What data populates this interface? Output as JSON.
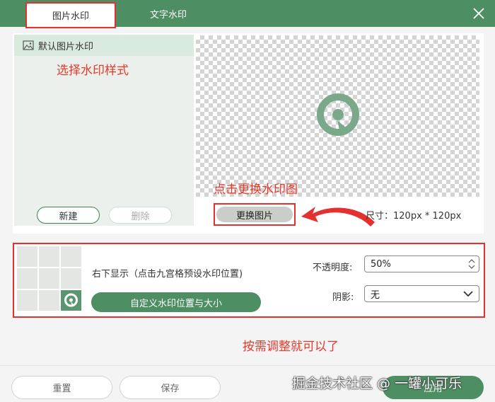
{
  "tabs": [
    "图片水印",
    "文字水印"
  ],
  "list": {
    "item_label": "默认图片水印",
    "new_button": "新建",
    "delete_button": "删除"
  },
  "preview": {
    "change_button": "更换图片",
    "size_label": "尺寸：120px * 120px"
  },
  "annotations": {
    "choose_style": "选择水印样式",
    "click_change": "点击更换水印图",
    "adjust": "按需调整就可以了"
  },
  "position": {
    "text": "右下显示（点击九宫格预设水印位置)",
    "custom_button": "自定义水印位置与大小"
  },
  "opacity": {
    "label": "不透明度:",
    "value": "50%"
  },
  "shadow": {
    "label": "阴影:",
    "value": "无"
  },
  "footer": {
    "reset": "重置",
    "save": "保存",
    "apply": "应用"
  },
  "watermark_overlay": "掘金技术社区 @ 一罐小可乐",
  "colors": {
    "primary": "#4d8f63",
    "annotation": "#e53a2c",
    "highlight_border": "#e53030"
  }
}
